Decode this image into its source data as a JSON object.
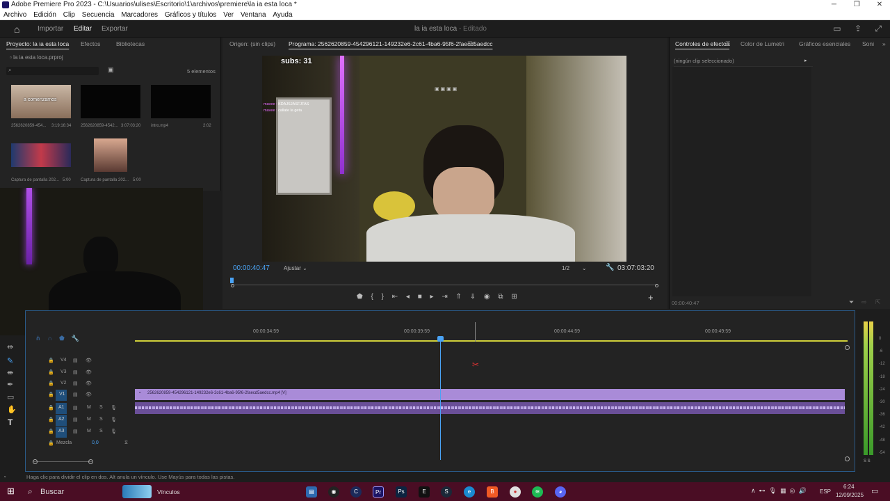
{
  "window": {
    "title": "Adobe Premiere Pro 2023 - C:\\Usuarios\\ulises\\Escritorio\\1\\archivos\\premiere\\la ia esta loca *",
    "minimize": "─",
    "maximize": "❐",
    "close": "✕"
  },
  "menu": [
    "Archivo",
    "Edición",
    "Clip",
    "Secuencia",
    "Marcadores",
    "Gráficos y títulos",
    "Ver",
    "Ventana",
    "Ayuda"
  ],
  "header": {
    "tabs": [
      "Importar",
      "Editar",
      "Exportar"
    ],
    "active_tab": "Editar",
    "doc_title": "la ia esta loca",
    "doc_status": "- Editado"
  },
  "project": {
    "tabs": [
      "Proyecto: la ia esta loca",
      "Efectos",
      "Bibliotecas"
    ],
    "file": "la ia esta loca.prproj",
    "count": "5 elementos",
    "items": [
      {
        "name": "2562620859-454...",
        "duration": "3:19:16:34",
        "overlay": "a comenzamos"
      },
      {
        "name": "2562620859-4542...",
        "duration": "3:07:03:20"
      },
      {
        "name": "intro.mp4",
        "duration": "2:02"
      },
      {
        "name": "Captura de pantalla 202...",
        "duration": "5:00"
      },
      {
        "name": "Captura de pantalla 202...",
        "duration": "5:00"
      }
    ]
  },
  "program": {
    "source_tab": "Origen: (sin clips)",
    "program_tab": "Programa: 2562620859-454296121-149232e6-2c61-4ba6-95f6-2faecd5aedcc",
    "timecode": "00:00:40:47",
    "fit": "Ajustar",
    "quality": "1/2",
    "duration": "03:07:03:20",
    "overlay_subs": "subs: 31",
    "chat": [
      {
        "user": "mavee :",
        "msg": "KDAJSJASFJFAS"
      },
      {
        "user": "mavee :",
        "msg": "callate la geta"
      }
    ]
  },
  "effects": {
    "tabs": [
      "Controles de efectos",
      "Color de Lumetri",
      "Gráficos esenciales",
      "Soni"
    ],
    "no_clip": "(ningún clip seleccionado)",
    "timecode": "00:00:40:47"
  },
  "timeline": {
    "ruler": [
      "00:00:34:59",
      "00:00:39:59",
      "00:00:44:59",
      "00:00:49:59"
    ],
    "video_tracks": [
      "V4",
      "V3",
      "V2",
      "V1"
    ],
    "audio_tracks": [
      "A1",
      "A2",
      "A3"
    ],
    "mix_label": "Mezcla",
    "mix_value": "0,0",
    "clip_label": "2562620859-454296121-149232e6-2c61-4ba6-95f6-2faecd5aedcc.mp4 [V]",
    "m": "M",
    "s": "S"
  },
  "meter": {
    "labels": [
      "0",
      "-6",
      "-12",
      "-18",
      "-24",
      "-30",
      "-36",
      "-42",
      "-48",
      "-54",
      "dB"
    ],
    "solo": "S S"
  },
  "status": "Haga clic para dividir el clip en dos. Alt anula un vínculo. Use Mayús para todas las pistas.",
  "taskbar": {
    "search": "Buscar",
    "weather": "Vínculos",
    "lang": "ESP",
    "time": "6:24",
    "date": "12/09/2025"
  }
}
